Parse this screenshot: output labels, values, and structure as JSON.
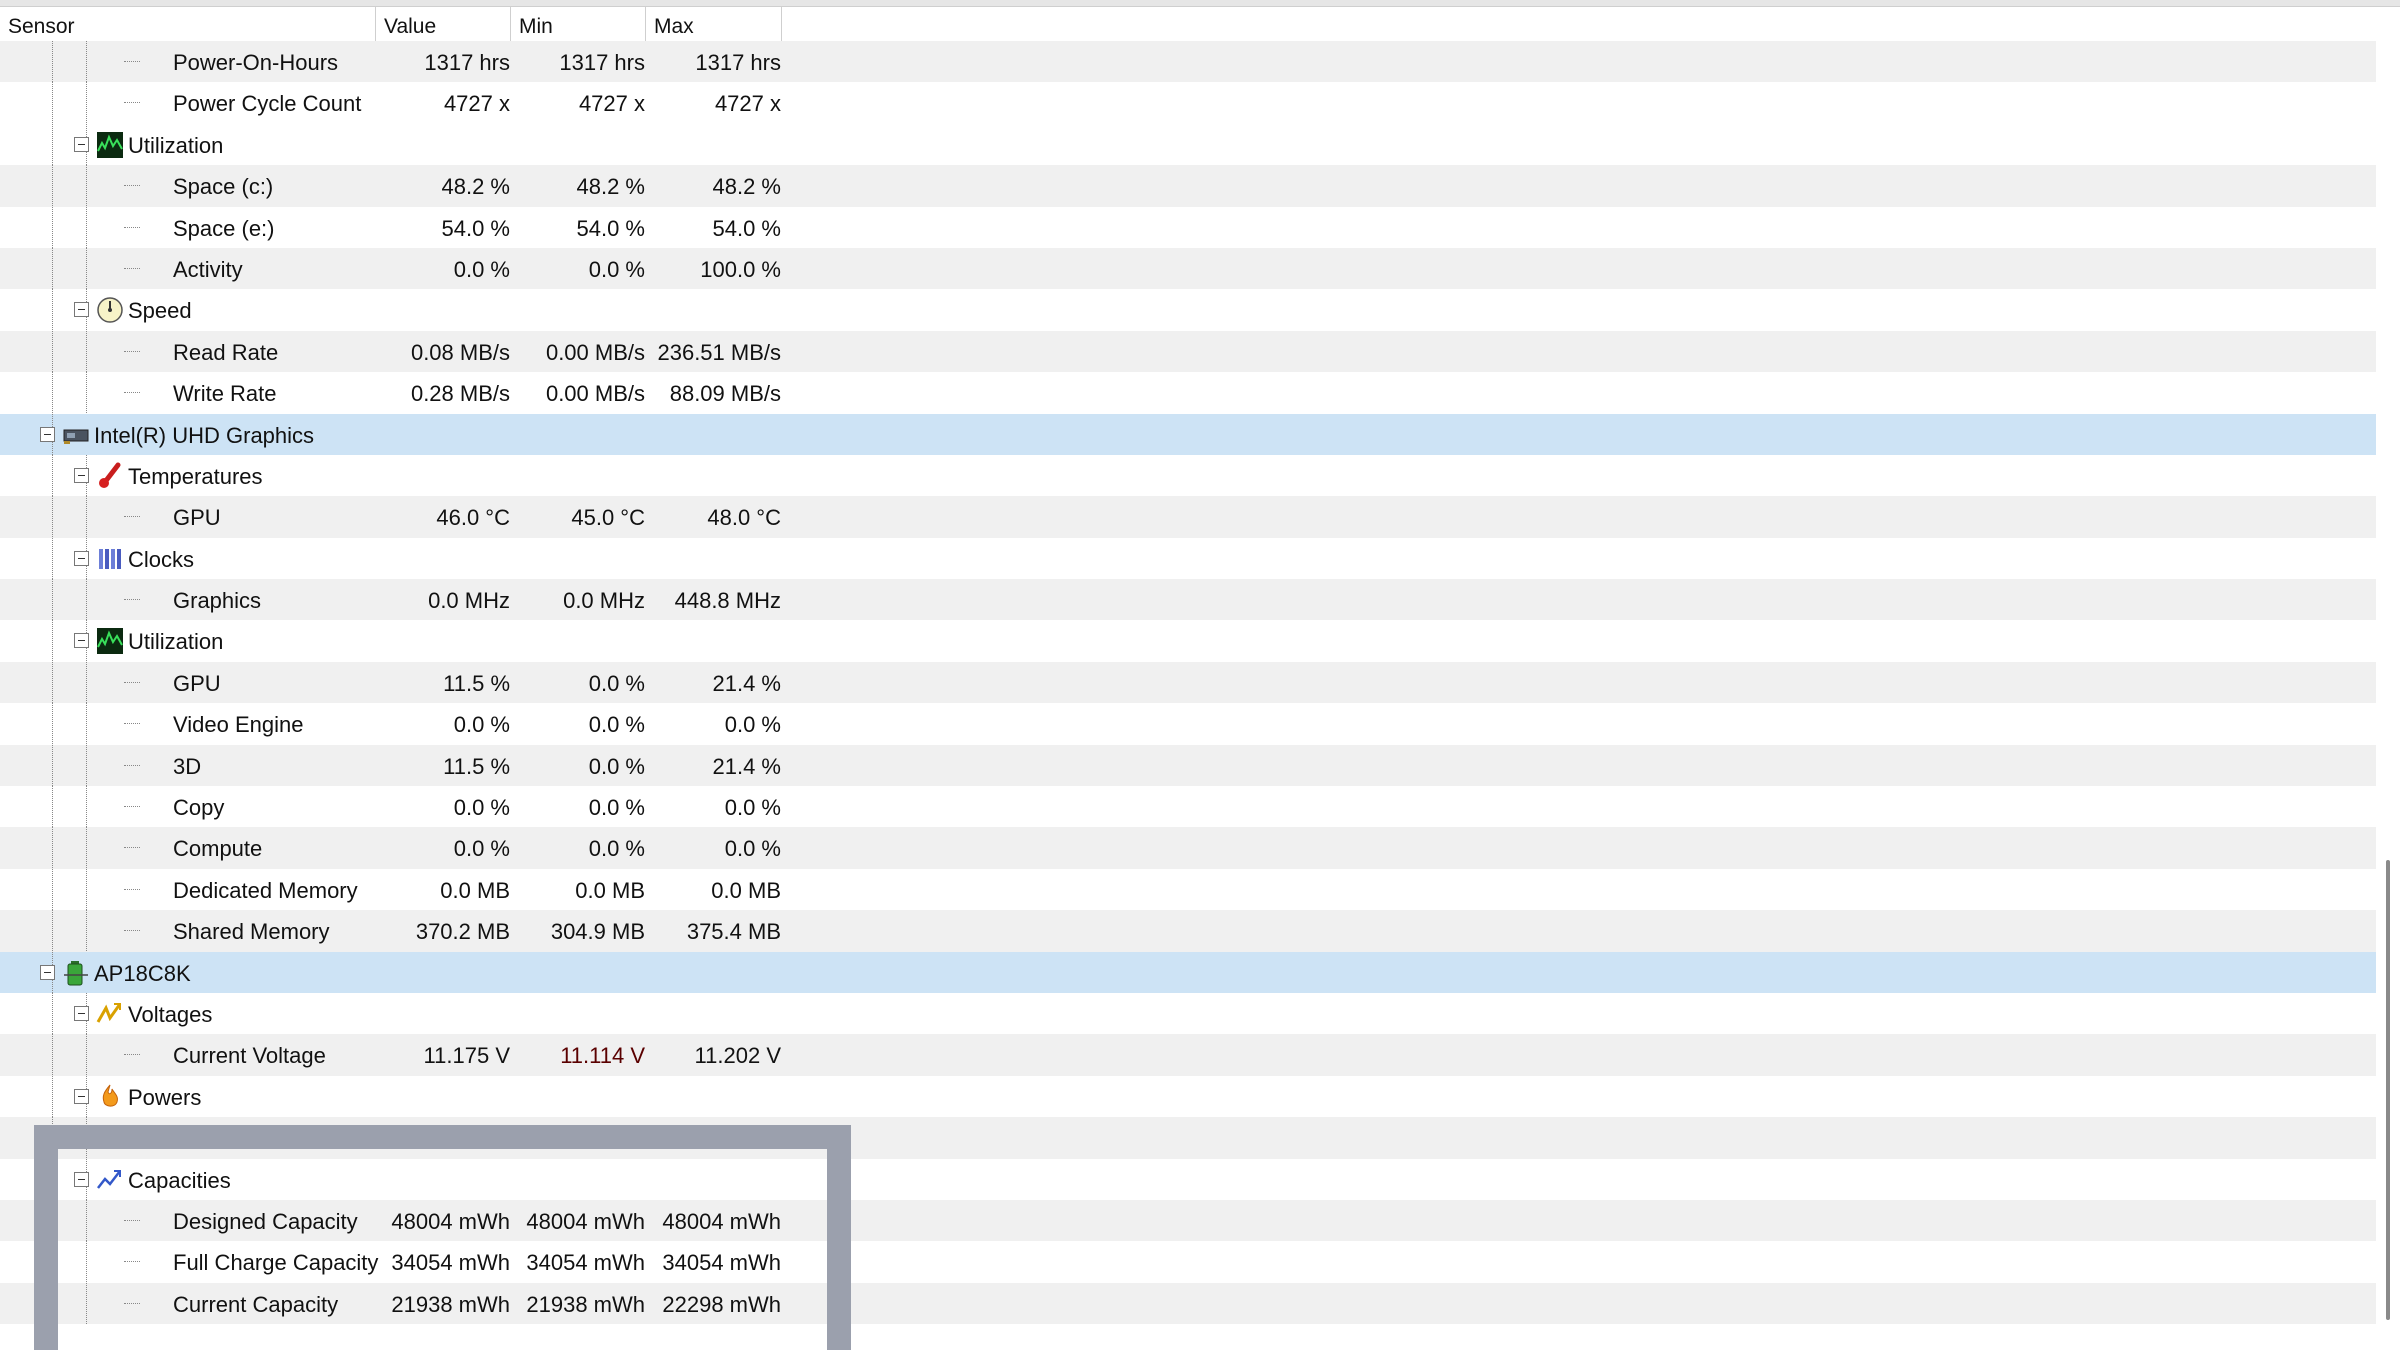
{
  "columns": {
    "sensor": "Sensor",
    "value": "Value",
    "min": "Min",
    "max": "Max"
  },
  "rows": [
    {
      "label": "Power-On-Hours",
      "value": "1317 hrs",
      "min": "1317 hrs",
      "max": "1317 hrs"
    },
    {
      "label": "Power Cycle Count",
      "value": "4727 x",
      "min": "4727 x",
      "max": "4727 x"
    },
    {
      "label": "Utilization"
    },
    {
      "label": "Space (c:)",
      "value": "48.2 %",
      "min": "48.2 %",
      "max": "48.2 %"
    },
    {
      "label": "Space (e:)",
      "value": "54.0 %",
      "min": "54.0 %",
      "max": "54.0 %"
    },
    {
      "label": "Activity",
      "value": "0.0 %",
      "min": "0.0 %",
      "max": "100.0 %"
    },
    {
      "label": "Speed"
    },
    {
      "label": "Read Rate",
      "value": "0.08 MB/s",
      "min": "0.00 MB/s",
      "max": "236.51 MB/s"
    },
    {
      "label": "Write Rate",
      "value": "0.28 MB/s",
      "min": "0.00 MB/s",
      "max": "88.09 MB/s"
    },
    {
      "label": "Intel(R) UHD Graphics"
    },
    {
      "label": "Temperatures"
    },
    {
      "label": "GPU",
      "value": "46.0 °C",
      "min": "45.0 °C",
      "max": "48.0 °C"
    },
    {
      "label": "Clocks"
    },
    {
      "label": "Graphics",
      "value": "0.0 MHz",
      "min": "0.0 MHz",
      "max": "448.8 MHz"
    },
    {
      "label": "Utilization"
    },
    {
      "label": "GPU",
      "value": "11.5 %",
      "min": "0.0 %",
      "max": "21.4 %"
    },
    {
      "label": "Video Engine",
      "value": "0.0 %",
      "min": "0.0 %",
      "max": "0.0 %"
    },
    {
      "label": "3D",
      "value": "11.5 %",
      "min": "0.0 %",
      "max": "21.4 %"
    },
    {
      "label": "Copy",
      "value": "0.0 %",
      "min": "0.0 %",
      "max": "0.0 %"
    },
    {
      "label": "Compute",
      "value": "0.0 %",
      "min": "0.0 %",
      "max": "0.0 %"
    },
    {
      "label": "Dedicated Memory",
      "value": "0.0 MB",
      "min": "0.0 MB",
      "max": "0.0 MB"
    },
    {
      "label": "Shared Memory",
      "value": "370.2 MB",
      "min": "304.9 MB",
      "max": "375.4 MB"
    },
    {
      "label": "AP18C8K"
    },
    {
      "label": "Voltages"
    },
    {
      "label": "Current Voltage",
      "value": "11.175 V",
      "min": "11.114 V",
      "max": "11.202 V"
    },
    {
      "label": "Powers"
    },
    {
      "label": ""
    },
    {
      "label": "Capacities"
    },
    {
      "label": "Designed Capacity",
      "value": "48004 mWh",
      "min": "48004 mWh",
      "max": "48004 mWh"
    },
    {
      "label": "Full Charge Capacity",
      "value": "34054 mWh",
      "min": "34054 mWh",
      "max": "34054 mWh"
    },
    {
      "label": "Current Capacity",
      "value": "21938 mWh",
      "min": "21938 mWh",
      "max": "22298 mWh"
    }
  ],
  "icons": {
    "utilization": "utilization-graph-icon",
    "speed": "speed-gauge-icon",
    "device": "graphics-card-icon",
    "temperatures": "thermometer-icon",
    "clocks": "clock-bars-icon",
    "battery": "battery-icon",
    "voltages": "voltage-icon",
    "powers": "power-flame-icon",
    "capacities": "capacity-chart-icon"
  },
  "colors": {
    "selected_row": "#cde3f5",
    "alt_row": "#f0f0f0",
    "overlay": "#9ba0ad"
  }
}
